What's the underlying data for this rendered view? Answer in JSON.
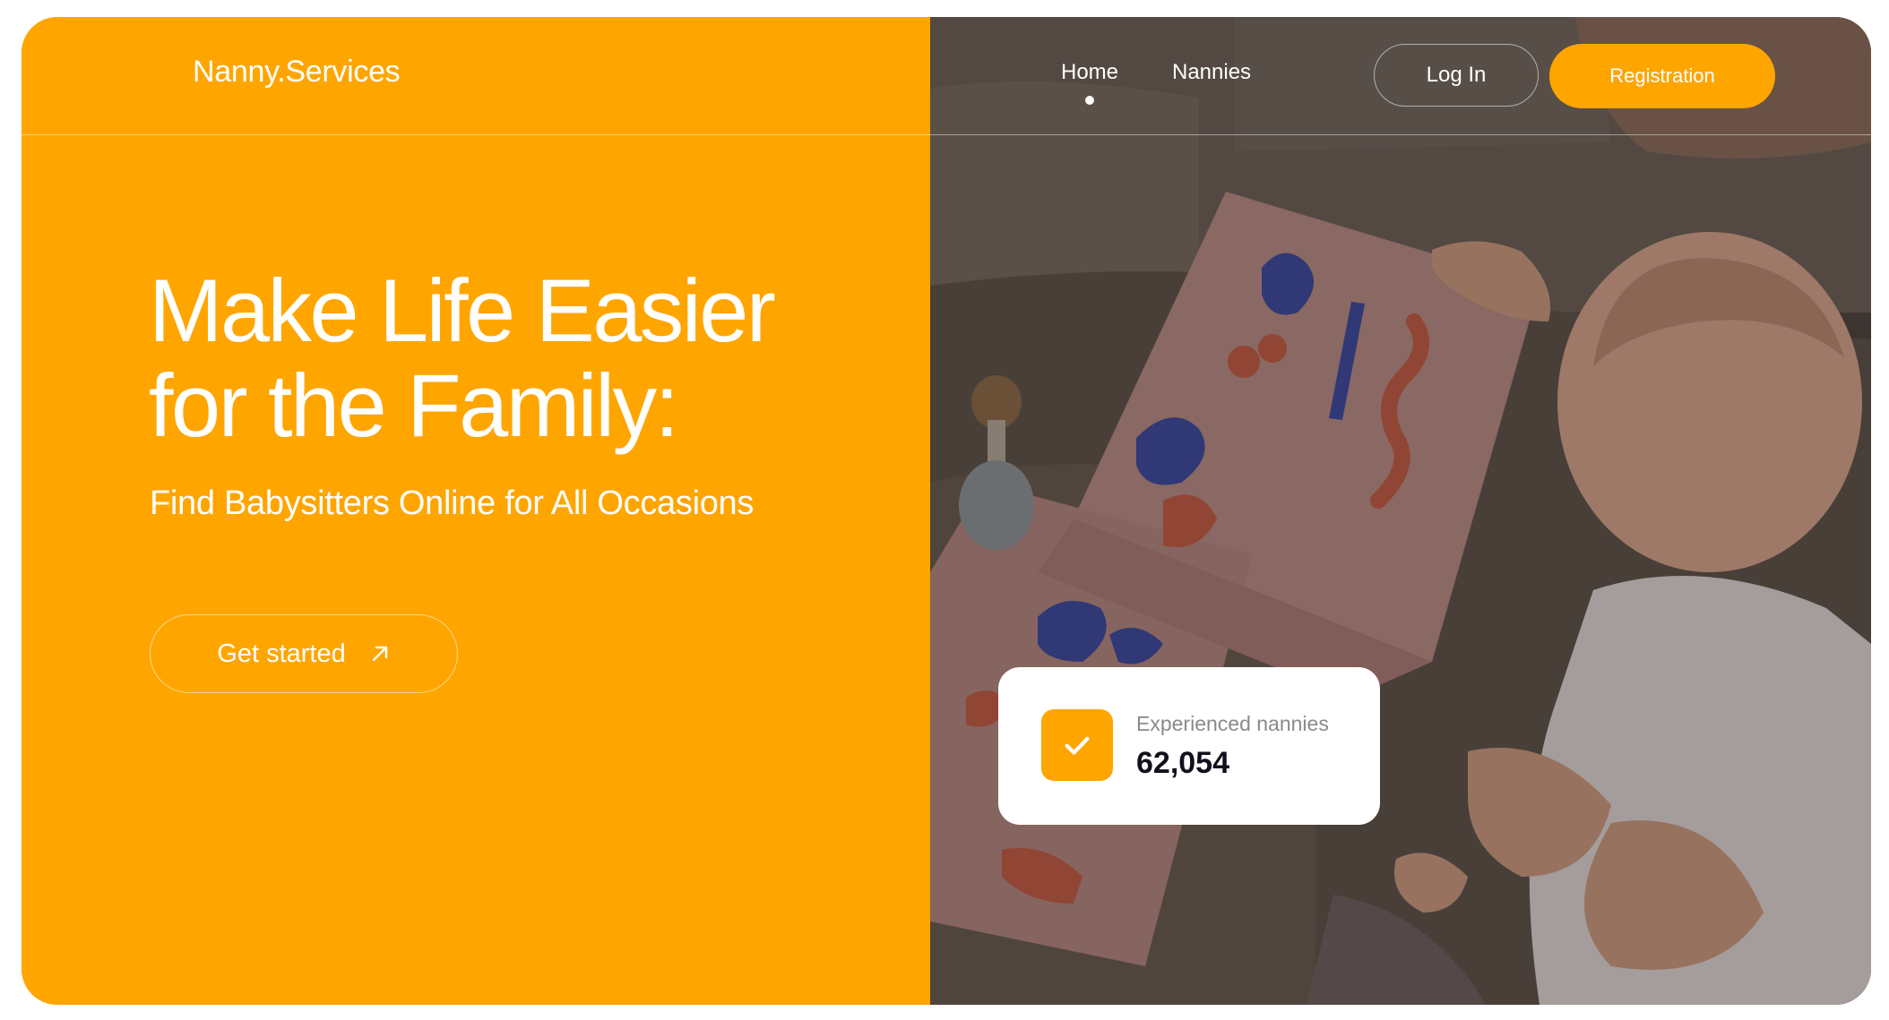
{
  "header": {
    "logo": "Nanny.Services",
    "nav": [
      {
        "label": "Home",
        "active": true
      },
      {
        "label": "Nannies",
        "active": false
      }
    ],
    "login_label": "Log In",
    "register_label": "Registration"
  },
  "hero": {
    "title_line1": "Make Life Easier",
    "title_line2": "for the Family:",
    "subtitle": "Find Babysitters Online for All Occasions",
    "cta_label": "Get started",
    "cta_icon": "arrow-up-right-icon"
  },
  "stat": {
    "label": "Experienced nannies",
    "value": "62,054",
    "icon": "check-icon"
  },
  "colors": {
    "accent": "#FFA500",
    "text_light": "#ffffff",
    "text_dark": "#11101c",
    "text_muted": "#8a8a8a"
  }
}
